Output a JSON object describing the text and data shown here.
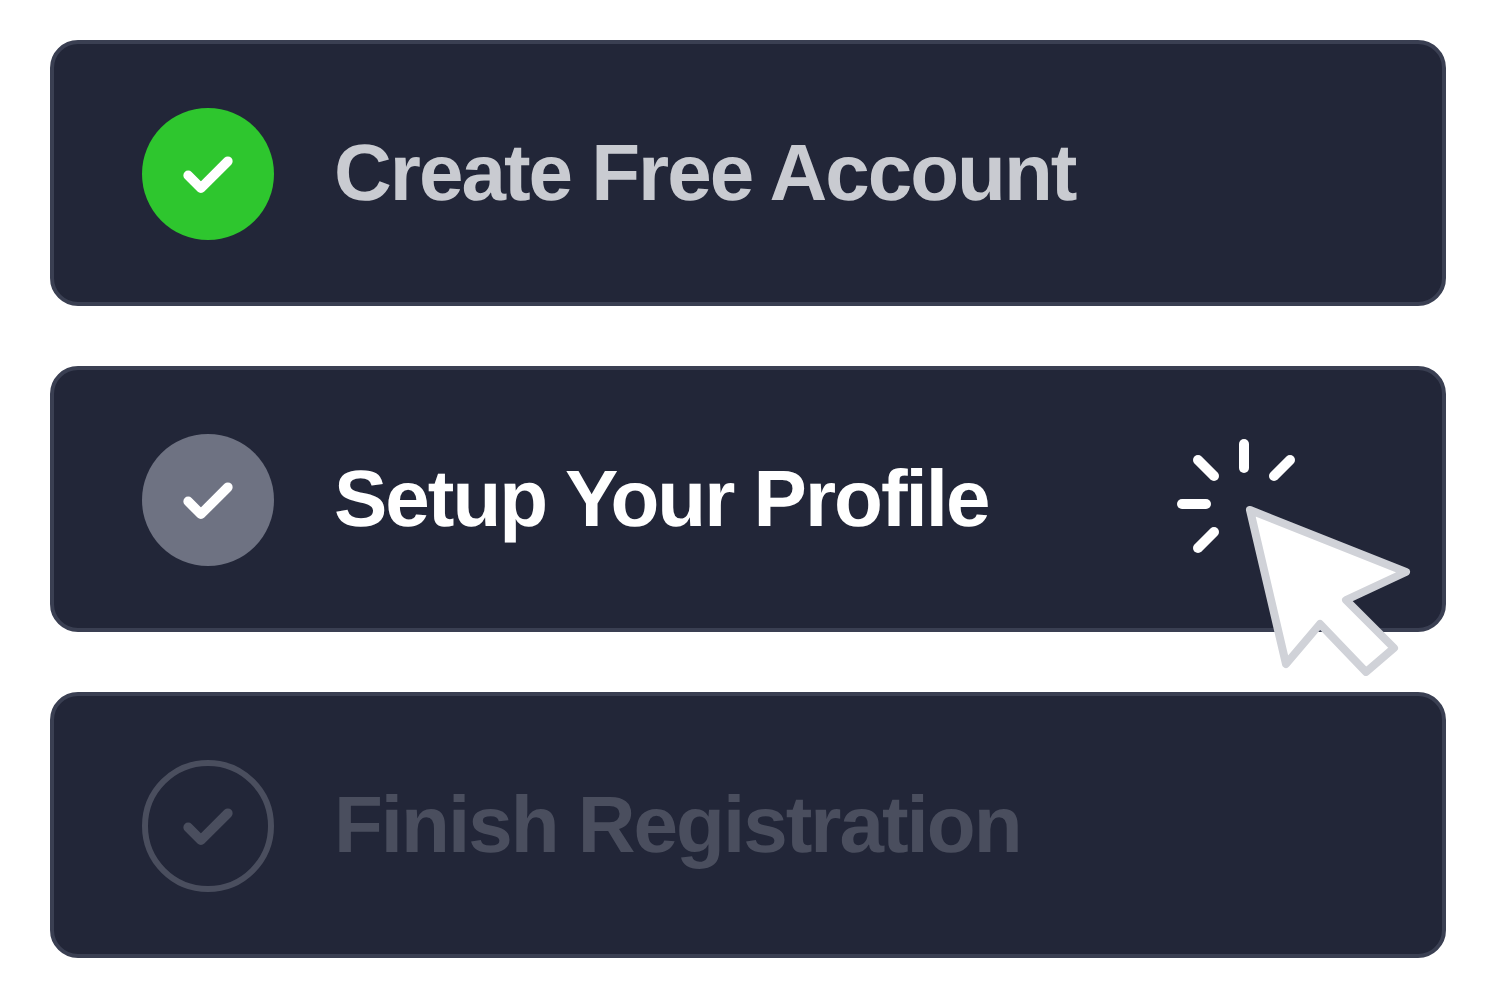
{
  "steps": [
    {
      "label": "Create Free Account",
      "kind": "done"
    },
    {
      "label": "Setup Your Profile",
      "kind": "current"
    },
    {
      "label": "Finish Registration",
      "kind": "pending"
    }
  ]
}
